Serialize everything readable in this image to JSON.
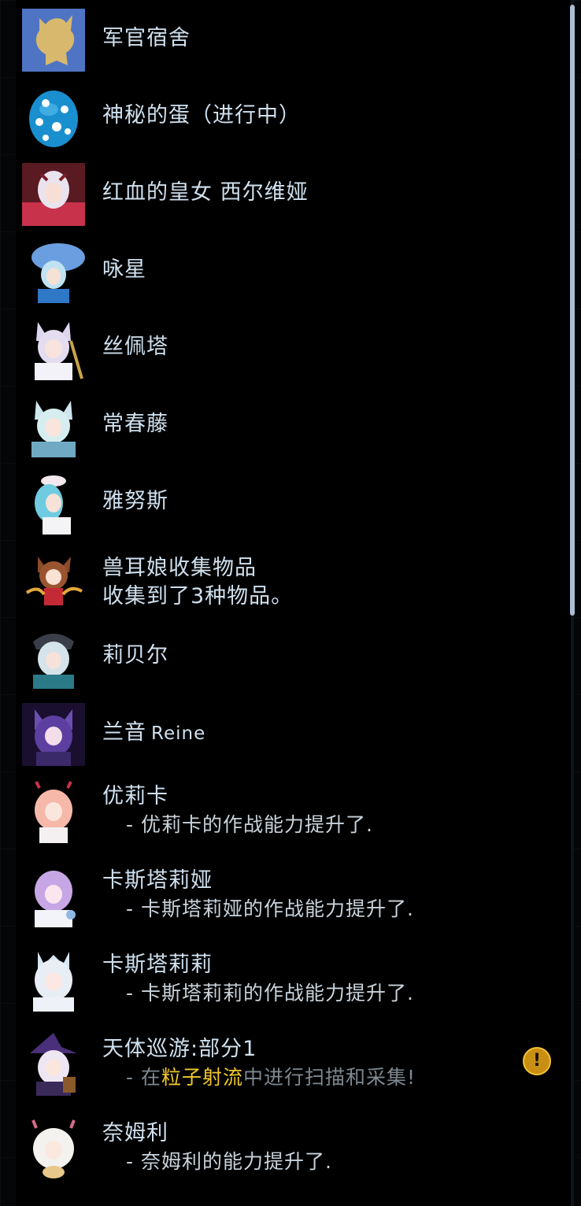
{
  "items": [
    {
      "title": "军官宿舍",
      "avatar_icon": "dorm-silhouette-icon"
    },
    {
      "title": "神秘的蛋（进行中）",
      "avatar_icon": "mystery-egg-icon"
    },
    {
      "title": "红血的皇女 西尔维娅",
      "avatar_icon": "character-portrait"
    },
    {
      "title": "咏星",
      "avatar_icon": "character-portrait"
    },
    {
      "title": "丝佩塔",
      "avatar_icon": "character-portrait"
    },
    {
      "title": "常春藤",
      "avatar_icon": "character-portrait"
    },
    {
      "title": "雅努斯",
      "avatar_icon": "character-portrait"
    },
    {
      "title": "兽耳娘收集物品",
      "line2": "收集到了3种物品。",
      "avatar_icon": "character-portrait"
    },
    {
      "title": "莉贝尔",
      "avatar_icon": "character-portrait"
    },
    {
      "title": "兰音",
      "title_latin": "Reine",
      "avatar_icon": "character-portrait"
    },
    {
      "title": "优莉卡",
      "sub": "- 优莉卡的作战能力提升了.",
      "avatar_icon": "character-portrait"
    },
    {
      "title": "卡斯塔莉娅",
      "sub": "- 卡斯塔莉娅的作战能力提升了.",
      "avatar_icon": "character-portrait"
    },
    {
      "title": "卡斯塔莉莉",
      "sub": "- 卡斯塔莉莉的作战能力提升了.",
      "avatar_icon": "character-portrait"
    },
    {
      "title": "天体巡游:部分1",
      "sub_prefix": "- 在",
      "sub_highlight": "粒子射流",
      "sub_suffix": "中进行扫描和采集!",
      "alert_icon": "!",
      "avatar_icon": "character-portrait"
    },
    {
      "title": "奈姆利",
      "sub": "- 奈姆利的能力提升了.",
      "avatar_icon": "character-portrait"
    }
  ],
  "colors": {
    "text": "#cfe0ee",
    "highlight": "#f2c92a",
    "alert": "#c98f12",
    "scrollbar": "#a9bfd4"
  }
}
